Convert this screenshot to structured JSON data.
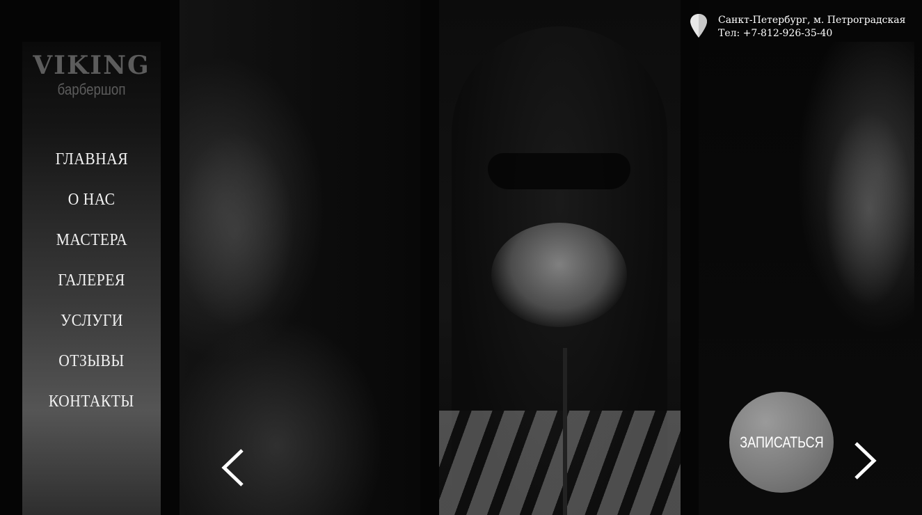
{
  "brand": {
    "title": "VIKING",
    "subtitle": "барбершоп"
  },
  "nav": {
    "items": [
      {
        "label": "ГЛАВНАЯ"
      },
      {
        "label": "О НАС"
      },
      {
        "label": "МАСТЕРА"
      },
      {
        "label": "ГАЛЕРЕЯ"
      },
      {
        "label": "УСЛУГИ"
      },
      {
        "label": "ОТЗЫВЫ"
      },
      {
        "label": "КОНТАКТЫ"
      }
    ]
  },
  "contact": {
    "icon": "location-pin-icon",
    "address": "Санкт-Петербург, м. Петроградская",
    "phone": "Тел: +7-812-926-35-40"
  },
  "slider": {
    "prev_icon": "chevron-left-icon",
    "next_icon": "chevron-right-icon"
  },
  "cta": {
    "label": "ЗАПИСАТЬСЯ"
  },
  "colors": {
    "background": "#050505",
    "text": "#ffffff",
    "logo": "#5c5c5c",
    "cta": "#7b7b7b"
  }
}
